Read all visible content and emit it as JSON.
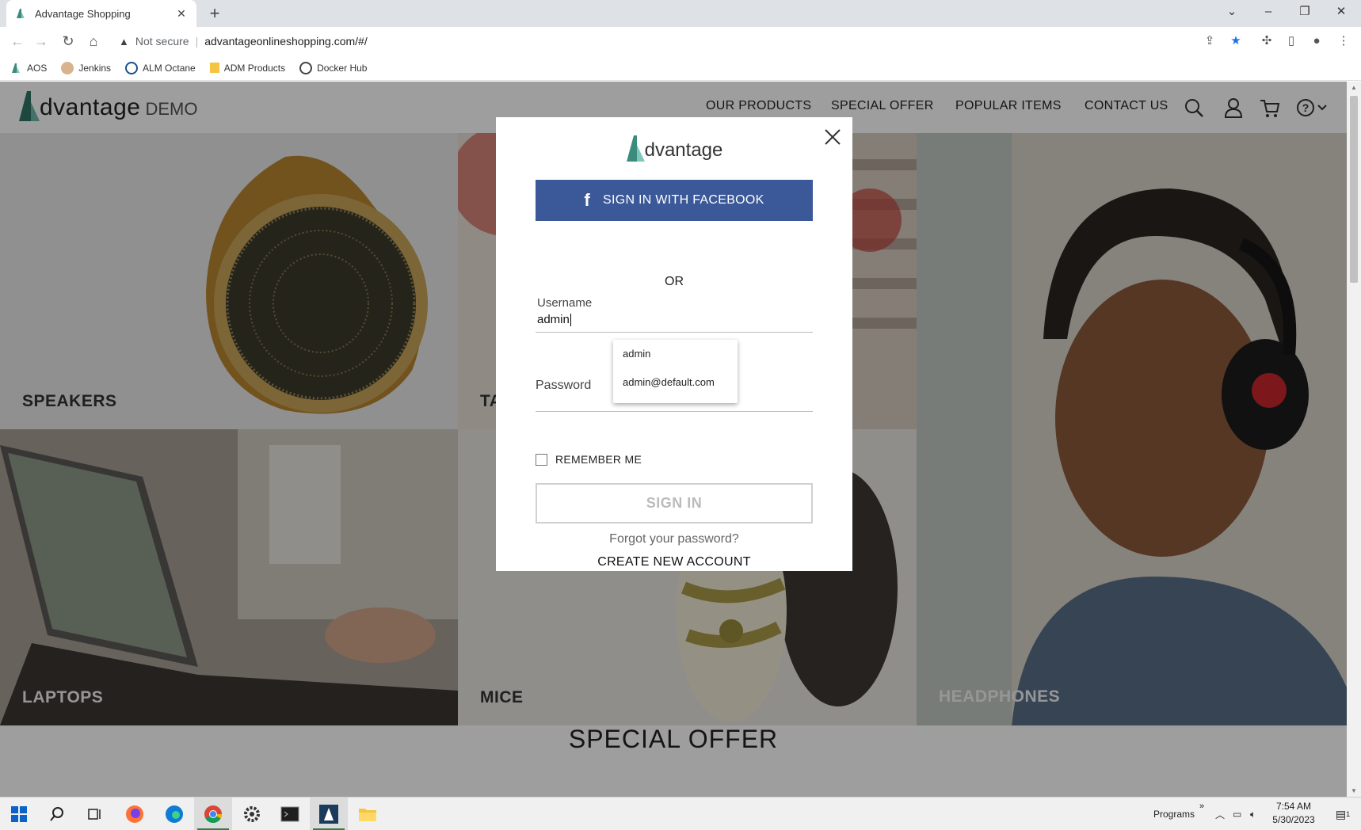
{
  "browser": {
    "tab_title": "Advantage Shopping",
    "address_warning": "Not secure",
    "url": "advantageonlineshopping.com/#/",
    "bookmarks": [
      {
        "label": "AOS",
        "icon": "aos-logo-icon"
      },
      {
        "label": "Jenkins",
        "icon": "jenkins-icon"
      },
      {
        "label": "ALM Octane",
        "icon": "octane-icon"
      },
      {
        "label": "ADM Products",
        "icon": "folder-icon"
      },
      {
        "label": "Docker Hub",
        "icon": "docker-icon"
      }
    ]
  },
  "site": {
    "logo_text": "dvantage",
    "logo_suffix": "DEMO",
    "nav": [
      "OUR PRODUCTS",
      "SPECIAL OFFER",
      "POPULAR ITEMS",
      "CONTACT US"
    ],
    "tiles": {
      "speakers": "SPEAKERS",
      "tablets": "TA",
      "laptops": "LAPTOPS",
      "mice": "MICE",
      "headphones": "HEADPHONES"
    },
    "special_offer_heading": "SPECIAL OFFER"
  },
  "login_modal": {
    "logo_text": "dvantage",
    "facebook_button": "SIGN IN WITH FACEBOOK",
    "or_text": "OR",
    "username_label": "Username",
    "username_value": "admin",
    "password_label": "Password",
    "autocomplete": [
      "admin",
      "admin@default.com"
    ],
    "remember_me": "REMEMBER ME",
    "sign_in_button": "SIGN IN",
    "forgot_password": "Forgot your password?",
    "create_account": "CREATE NEW ACCOUNT"
  },
  "taskbar": {
    "programs_label": "Programs",
    "time": "7:54 AM",
    "date": "5/30/2023",
    "notification_count": "1"
  },
  "colors": {
    "brand_teal": "#3b8c7f",
    "facebook_blue": "#3b5998",
    "overlay": "rgba(0,0,0,0.38)"
  }
}
